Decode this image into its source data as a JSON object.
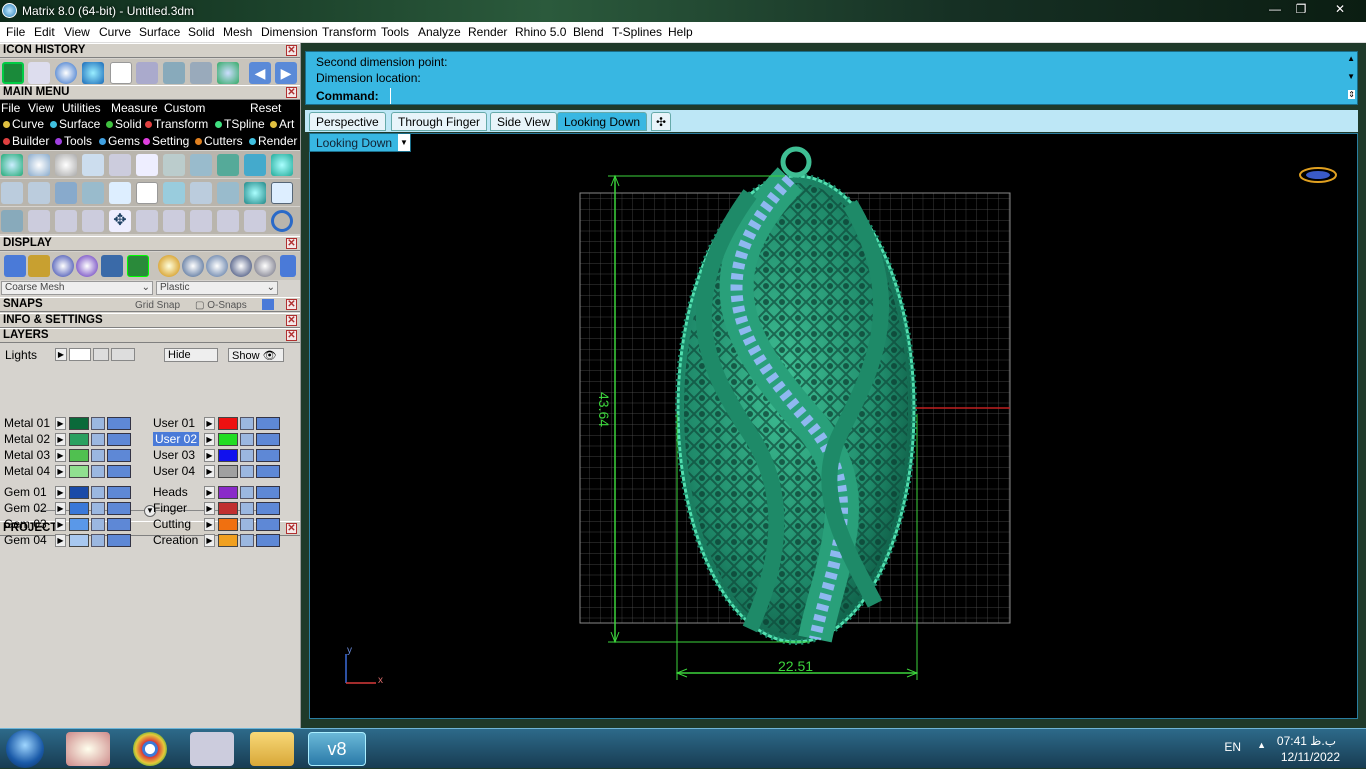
{
  "window": {
    "title": "Matrix 8.0 (64-bit) - Untitled.3dm",
    "buttons": [
      "—",
      "❐",
      "✕"
    ]
  },
  "menubar": [
    "File",
    "Edit",
    "View",
    "Curve",
    "Surface",
    "Solid",
    "Mesh",
    "Dimension",
    "Transform",
    "Tools",
    "Analyze",
    "Render",
    "Rhino 5.0",
    "Blend",
    "T-Splines",
    "Help"
  ],
  "panels": {
    "icon_history": "ICON HISTORY",
    "main_menu": "MAIN MENU",
    "display": "DISPLAY",
    "snaps": "SNAPS",
    "info": "INFO & SETTINGS",
    "layers": "LAYERS",
    "projects": "PROJECTS"
  },
  "main_menu": {
    "items": [
      "File",
      "View",
      "Utilities",
      "Measure",
      "Custom"
    ],
    "reset": "Reset"
  },
  "categories_row1": [
    {
      "label": "Curve",
      "color": "#e0c040"
    },
    {
      "label": "Surface",
      "color": "#40c0e0"
    },
    {
      "label": "Solid",
      "color": "#40c040"
    },
    {
      "label": "Transform",
      "color": "#e04040"
    },
    {
      "label": "TSpline",
      "color": "#40e080"
    },
    {
      "label": "Art",
      "color": "#e0c040"
    }
  ],
  "categories_row2": [
    {
      "label": "Builder",
      "color": "#e04040"
    },
    {
      "label": "Tools",
      "color": "#a040e0"
    },
    {
      "label": "Gems",
      "color": "#40a0e0"
    },
    {
      "label": "Setting",
      "color": "#e040e0"
    },
    {
      "label": "Cutters",
      "color": "#e08020"
    },
    {
      "label": "Render",
      "color": "#40c0e0"
    }
  ],
  "display": {
    "mesh": "Coarse Mesh",
    "material": "Plastic"
  },
  "snaps": {
    "grid": "Grid Snap",
    "osnap": "O-Snaps"
  },
  "layers": {
    "lights": "Lights",
    "hide": "Hide",
    "show": "Show",
    "left": [
      {
        "name": "Metal 01",
        "color": "#0a6a3a"
      },
      {
        "name": "Metal 02",
        "color": "#2aa060"
      },
      {
        "name": "Metal 03",
        "color": "#50c050"
      },
      {
        "name": "Metal 04",
        "color": "#90e090"
      },
      {
        "name": "Gem 01",
        "color": "#1a4aa8"
      },
      {
        "name": "Gem 02",
        "color": "#3a78d8"
      },
      {
        "name": "Gem 03",
        "color": "#5a98e8"
      },
      {
        "name": "Gem 04",
        "color": "#a8c8f0"
      }
    ],
    "right": [
      {
        "name": "User 01",
        "color": "#ee1111"
      },
      {
        "name": "User 02",
        "color": "#22dd22"
      },
      {
        "name": "User 03",
        "color": "#1111ee"
      },
      {
        "name": "User 04",
        "color": "#a0a0a0"
      },
      {
        "name": "Heads",
        "color": "#8a2ac8"
      },
      {
        "name": "Finger",
        "color": "#c03030"
      },
      {
        "name": "Cutting",
        "color": "#f07010"
      },
      {
        "name": "Creation",
        "color": "#f0a020"
      }
    ]
  },
  "command": {
    "line1": "Second dimension point:",
    "line2": "Dimension location:",
    "prompt": "Command:"
  },
  "viewport_tabs": [
    "Perspective",
    "Through Finger",
    "Side View",
    "Looking Down"
  ],
  "active_tab": "Looking Down",
  "add_tab": "✣",
  "viewport_name": "Looking Down",
  "dimensions": {
    "height": "43.64",
    "width": "22.51"
  },
  "axes": {
    "x": "x",
    "y": "y"
  },
  "tray": {
    "lang": "EN",
    "time": "07:41 ب.ظ",
    "date": "12/11/2022"
  }
}
